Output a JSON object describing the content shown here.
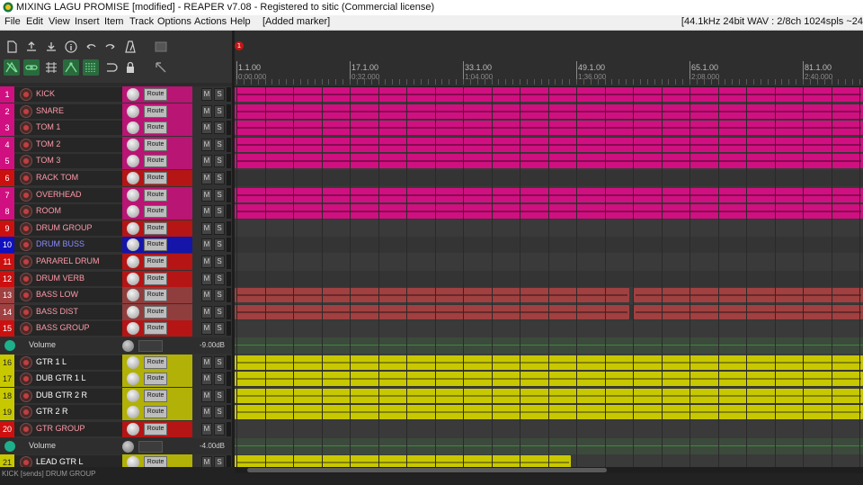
{
  "window": {
    "title": "MIXING LAGU PROMISE [modified] - REAPER v7.08 - Registered to sitic (Commercial license)"
  },
  "menu": {
    "items": [
      "File",
      "Edit",
      "View",
      "Insert",
      "Item",
      "Track",
      "Options",
      "Actions",
      "Help"
    ],
    "notice": "[Added marker]",
    "status": "[44.1kHz 24bit WAV : 2/8ch 1024spls ~24"
  },
  "toolbar": {
    "icons": [
      "new-project",
      "open-project",
      "save-project",
      "project-settings",
      "undo",
      "redo",
      "metronome",
      "grid-snap",
      "ripple-editing",
      "link-icon",
      "grid-icon",
      "envelope-points-icon",
      "snap-icon",
      "loop-icon",
      "lock-icon",
      "trim-icon"
    ]
  },
  "ruler": {
    "marker_number": "1",
    "labels": [
      {
        "bar": "1.1.00",
        "time": "0:00.000"
      },
      {
        "bar": "17.1.00",
        "time": "0:32.000"
      },
      {
        "bar": "33.1.00",
        "time": "1:04.000"
      },
      {
        "bar": "49.1.00",
        "time": "1:36.000"
      },
      {
        "bar": "65.1.00",
        "time": "2:08.000"
      },
      {
        "bar": "81.1.00",
        "time": "2:40.000"
      }
    ]
  },
  "track_common": {
    "route_label": "Route",
    "mute_label": "M",
    "solo_label": "S"
  },
  "tracks": [
    {
      "num": "1",
      "name": "KICK",
      "color": "#d01080"
    },
    {
      "num": "2",
      "name": "SNARE",
      "color": "#d01080"
    },
    {
      "num": "3",
      "name": "TOM 1",
      "color": "#d01080"
    },
    {
      "num": "4",
      "name": "TOM 2",
      "color": "#d01080"
    },
    {
      "num": "5",
      "name": "TOM 3",
      "color": "#d01080"
    },
    {
      "num": "6",
      "name": "RACK TOM",
      "color": "#cc1010"
    },
    {
      "num": "7",
      "name": "OVERHEAD",
      "color": "#d01080"
    },
    {
      "num": "8",
      "name": "ROOM",
      "color": "#d01080"
    },
    {
      "num": "9",
      "name": "DRUM GROUP",
      "color": "#cc1010"
    },
    {
      "num": "10",
      "name": "DRUM BUSS",
      "color": "#1010c0"
    },
    {
      "num": "11",
      "name": "PARAREL DRUM",
      "color": "#cc1010"
    },
    {
      "num": "12",
      "name": "DRUM VERB",
      "color": "#cc1010"
    },
    {
      "num": "13",
      "name": "BASS LOW",
      "color": "#a04040"
    },
    {
      "num": "14",
      "name": "BASS DIST",
      "color": "#a04040"
    },
    {
      "num": "15",
      "name": "BASS GROUP",
      "color": "#cc1010"
    },
    {
      "num": "16",
      "name": "GTR 1 L",
      "color": "#c8c800"
    },
    {
      "num": "17",
      "name": "DUB GTR 1 L",
      "color": "#c8c800"
    },
    {
      "num": "18",
      "name": "DUB GTR 2 R",
      "color": "#c8c800"
    },
    {
      "num": "19",
      "name": "GTR 2 R",
      "color": "#c8c800"
    },
    {
      "num": "20",
      "name": "GTR GROUP",
      "color": "#cc1010"
    },
    {
      "num": "21",
      "name": "LEAD GTR L",
      "color": "#c8c800"
    }
  ],
  "envelopes": [
    {
      "label": "Volume",
      "value": "-9.00dB"
    },
    {
      "label": "Volume",
      "value": "-4.00dB"
    }
  ],
  "statusbar": {
    "info": "KICK [sends] DRUM GROUP"
  }
}
